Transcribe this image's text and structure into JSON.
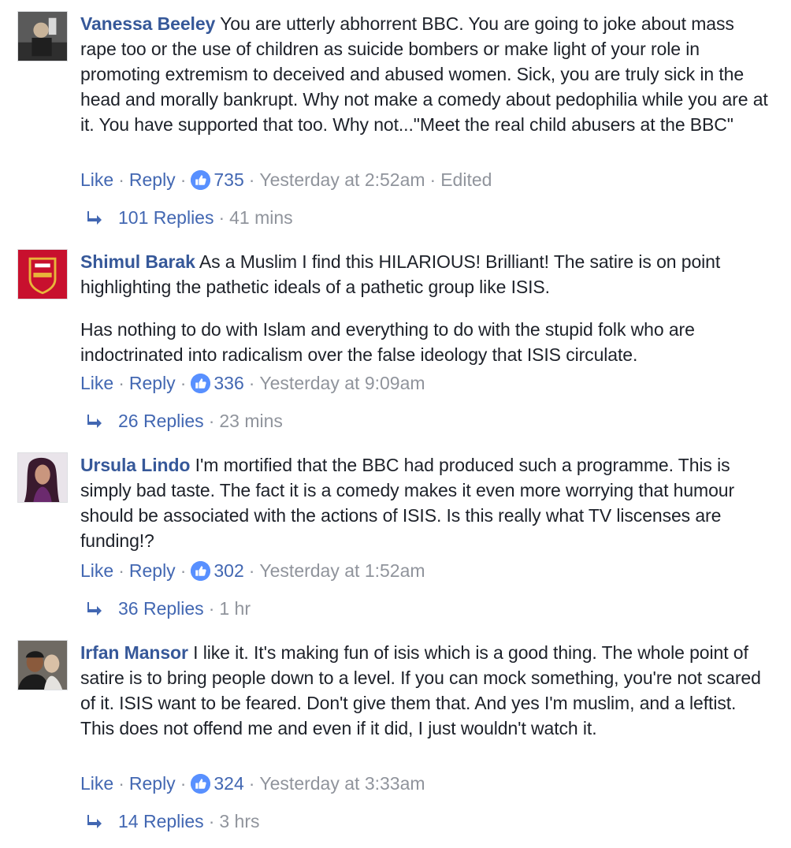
{
  "comments": [
    {
      "author": "Vanessa Beeley",
      "paragraphs": [
        "You are utterly abhorrent BBC. You are going to joke about mass rape too or the use of children as suicide bombers or make light of your role in promoting extremism to deceived and abused women. Sick, you are truly sick in the head and morally bankrupt. Why not make a comedy about pedophilia while you are at it. You have supported that too. Why not...\"Meet the real child abusers at the BBC\""
      ],
      "like_label": "Like",
      "reply_label": "Reply",
      "reactions": "735",
      "timestamp": "Yesterday at 2:52am",
      "edited": "Edited",
      "replies_label": "101 Replies",
      "replies_time": "41 mins"
    },
    {
      "author": "Shimul Barak",
      "paragraphs": [
        "As a Muslim I find this HILARIOUS! Brilliant! The satire is on point highlighting the pathetic ideals of a pathetic group like ISIS.",
        "Has nothing to do with Islam and everything to do with the stupid folk who are indoctrinated into radicalism over the false ideology that ISIS circulate."
      ],
      "like_label": "Like",
      "reply_label": "Reply",
      "reactions": "336",
      "timestamp": "Yesterday at 9:09am",
      "replies_label": "26 Replies",
      "replies_time": "23 mins"
    },
    {
      "author": "Ursula Lindo",
      "paragraphs": [
        "I'm mortified that the BBC had produced such a programme. This is simply bad taste. The fact it is a comedy makes it even more worrying that humour should be associated with the actions of ISIS. Is this really what TV liscenses are funding!?"
      ],
      "like_label": "Like",
      "reply_label": "Reply",
      "reactions": "302",
      "timestamp": "Yesterday at 1:52am",
      "replies_label": "36 Replies",
      "replies_time": "1 hr"
    },
    {
      "author": "Irfan Mansor",
      "paragraphs": [
        "I like it. It's making fun of isis which is a good thing. The whole point of satire is to bring people down to a level. If you can mock something, you're not scared of it. ISIS want to be feared. Don't give them that. And yes I'm muslim, and a leftist. This does not offend me and even if it did, I just wouldn't watch it."
      ],
      "like_label": "Like",
      "reply_label": "Reply",
      "reactions": "324",
      "timestamp": "Yesterday at 3:33am",
      "replies_label": "14 Replies",
      "replies_time": "3 hrs"
    }
  ],
  "separator": "·",
  "icons": {
    "like_reaction": "thumbs-up-icon",
    "reply_arrow": "reply-arrow-icon"
  },
  "colors": {
    "author_link": "#365899",
    "action_link": "#4267b2",
    "meta_gray": "#90949c",
    "like_badge": "#5890ff"
  }
}
